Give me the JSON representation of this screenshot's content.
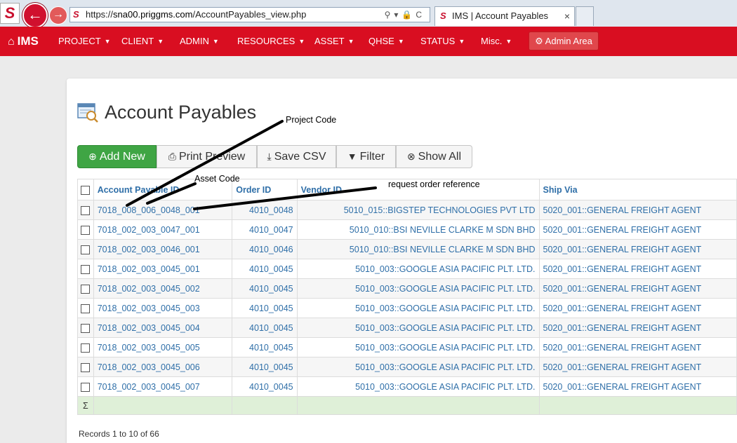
{
  "browser": {
    "app_icon": "S",
    "back_icon": "left-arrow-icon",
    "forward_icon": "right-arrow-icon",
    "url_prefix": "https://",
    "url_host": "sna00.priggms.com",
    "url_path": "/AccountPayables_view.php",
    "tab_icon": "S",
    "tab_title": "IMS | Account Payables",
    "tab_close": "×"
  },
  "navbar": {
    "brand": "IMS",
    "items": [
      "PROJECT",
      "CLIENT",
      "ADMIN",
      "RESOURCES",
      "ASSET",
      "QHSE",
      "STATUS",
      "Misc."
    ],
    "admin_area": "Admin Area",
    "color": "#d90e21"
  },
  "page": {
    "title": "Account Payables"
  },
  "toolbar": {
    "add_new": "Add New",
    "print_preview": "Print Preview",
    "save_csv": "Save CSV",
    "filter": "Filter",
    "show_all": "Show All"
  },
  "table": {
    "columns": [
      "Account Payable ID",
      "Order ID",
      "Vendor ID",
      "Ship Via"
    ],
    "rows": [
      [
        "7018_008_006_0048_001",
        "4010_0048",
        "5010_015::BIGSTEP TECHNOLOGIES PVT LTD",
        "5020_001::GENERAL FREIGHT AGENT"
      ],
      [
        "7018_002_003_0047_001",
        "4010_0047",
        "5010_010::BSI NEVILLE CLARKE M SDN BHD",
        "5020_001::GENERAL FREIGHT AGENT"
      ],
      [
        "7018_002_003_0046_001",
        "4010_0046",
        "5010_010::BSI NEVILLE CLARKE M SDN BHD",
        "5020_001::GENERAL FREIGHT AGENT"
      ],
      [
        "7018_002_003_0045_001",
        "4010_0045",
        "5010_003::GOOGLE ASIA PACIFIC PLT. LTD.",
        "5020_001::GENERAL FREIGHT AGENT"
      ],
      [
        "7018_002_003_0045_002",
        "4010_0045",
        "5010_003::GOOGLE ASIA PACIFIC PLT. LTD.",
        "5020_001::GENERAL FREIGHT AGENT"
      ],
      [
        "7018_002_003_0045_003",
        "4010_0045",
        "5010_003::GOOGLE ASIA PACIFIC PLT. LTD.",
        "5020_001::GENERAL FREIGHT AGENT"
      ],
      [
        "7018_002_003_0045_004",
        "4010_0045",
        "5010_003::GOOGLE ASIA PACIFIC PLT. LTD.",
        "5020_001::GENERAL FREIGHT AGENT"
      ],
      [
        "7018_002_003_0045_005",
        "4010_0045",
        "5010_003::GOOGLE ASIA PACIFIC PLT. LTD.",
        "5020_001::GENERAL FREIGHT AGENT"
      ],
      [
        "7018_002_003_0045_006",
        "4010_0045",
        "5010_003::GOOGLE ASIA PACIFIC PLT. LTD.",
        "5020_001::GENERAL FREIGHT AGENT"
      ],
      [
        "7018_002_003_0045_007",
        "4010_0045",
        "5010_003::GOOGLE ASIA PACIFIC PLT. LTD.",
        "5020_001::GENERAL FREIGHT AGENT"
      ]
    ],
    "sum_symbol": "Σ",
    "records_text": "Records 1 to 10 of 66"
  },
  "annotations": {
    "project_code": "Project Code",
    "asset_code": "Asset Code",
    "request_order_reference": "request order reference"
  }
}
